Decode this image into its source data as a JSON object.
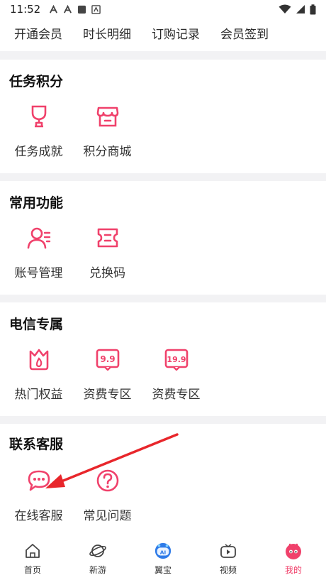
{
  "status_bar": {
    "time": "11:52"
  },
  "membership_links": [
    "开通会员",
    "时长明细",
    "订购记录",
    "会员签到"
  ],
  "sections": {
    "tasks": {
      "title": "任务积分",
      "items": [
        {
          "label": "任务成就",
          "icon": "trophy-icon"
        },
        {
          "label": "积分商城",
          "icon": "store-icon"
        }
      ]
    },
    "common": {
      "title": "常用功能",
      "items": [
        {
          "label": "账号管理",
          "icon": "account-icon"
        },
        {
          "label": "兑换码",
          "icon": "ticket-icon"
        }
      ]
    },
    "telecom": {
      "title": "电信专属",
      "items": [
        {
          "label": "热门权益",
          "icon": "flame-crown-icon"
        },
        {
          "label": "资费专区",
          "icon": "price-tag-icon",
          "badge": "9.9"
        },
        {
          "label": "资费专区",
          "icon": "price-tag-icon",
          "badge": "19.9"
        }
      ]
    },
    "service": {
      "title": "联系客服",
      "items": [
        {
          "label": "在线客服",
          "icon": "chat-bubble-icon"
        },
        {
          "label": "常见问题",
          "icon": "question-icon"
        }
      ]
    }
  },
  "bottom_nav": [
    {
      "label": "首页",
      "icon": "home-icon",
      "active": false
    },
    {
      "label": "新游",
      "icon": "planet-icon",
      "active": false
    },
    {
      "label": "翼宝",
      "icon": "ai-robot-icon",
      "active": false
    },
    {
      "label": "视频",
      "icon": "tv-icon",
      "active": false
    },
    {
      "label": "我的",
      "icon": "profile-face-icon",
      "active": true
    }
  ],
  "colors": {
    "accent": "#f0416b",
    "annotation_arrow": "#e8262b",
    "page_background": "#f2f2f4"
  }
}
